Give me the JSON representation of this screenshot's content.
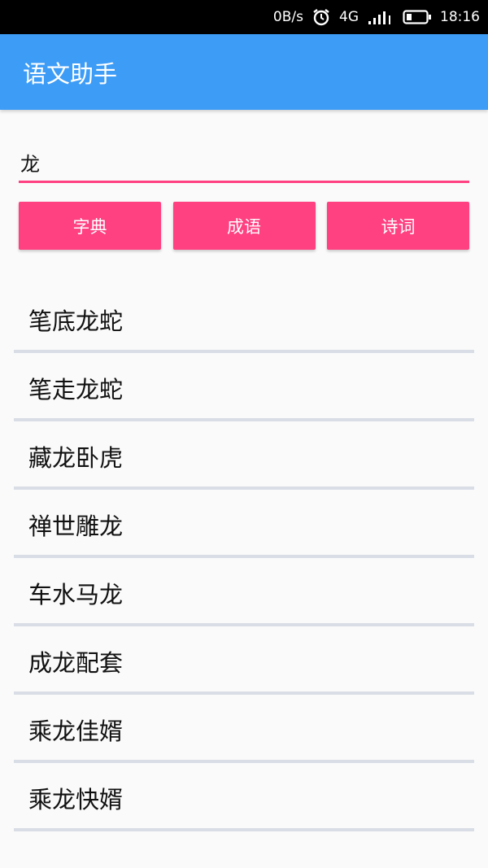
{
  "status_bar": {
    "net_speed": "0B/s",
    "network_type": "4G",
    "clock": "18:16",
    "icons": [
      "alarm-icon",
      "signal-icon",
      "battery-icon"
    ]
  },
  "app_bar": {
    "title": "语文助手"
  },
  "search": {
    "value": "龙"
  },
  "buttons": {
    "dictionary": "字典",
    "idiom": "成语",
    "poetry": "诗词"
  },
  "results": [
    "笔底龙蛇",
    "笔走龙蛇",
    "藏龙卧虎",
    "禅世雕龙",
    "车水马龙",
    "成龙配套",
    "乘龙佳婿",
    "乘龙快婿"
  ],
  "colors": {
    "app_bar": "#3d9cf6",
    "accent": "#ff4081",
    "divider": "#d9dde5"
  }
}
